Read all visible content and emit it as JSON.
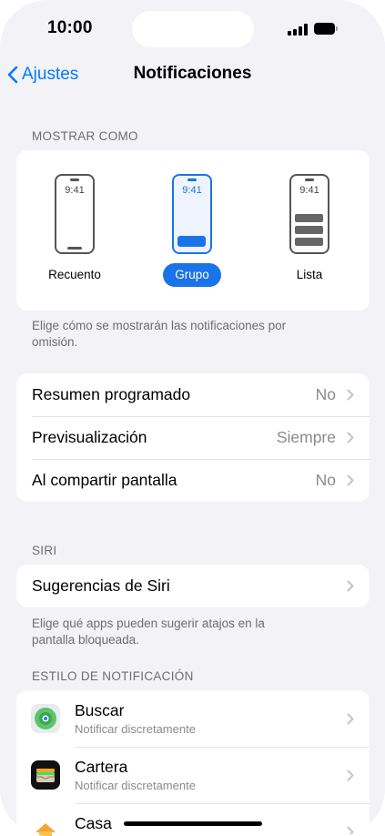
{
  "status_bar": {
    "time": "10:00"
  },
  "nav": {
    "back_label": "Ajustes",
    "title": "Notificaciones"
  },
  "display_as": {
    "header": "MOSTRAR COMO",
    "options": [
      {
        "label": "Recuento",
        "time": "9:41",
        "selected": false
      },
      {
        "label": "Grupo",
        "time": "9:41",
        "selected": true
      },
      {
        "label": "Lista",
        "time": "9:41",
        "selected": false
      }
    ],
    "footer": "Elige cómo se mostrarán las notificaciones por omisión."
  },
  "general": [
    {
      "label": "Resumen programado",
      "value": "No"
    },
    {
      "label": "Previsualización",
      "value": "Siempre"
    },
    {
      "label": "Al compartir pantalla",
      "value": "No"
    }
  ],
  "siri": {
    "header": "SIRI",
    "row_label": "Sugerencias de Siri",
    "footer": "Elige qué apps pueden sugerir atajos en la pantalla bloqueada."
  },
  "notification_style": {
    "header": "ESTILO DE NOTIFICACIÓN",
    "apps": [
      {
        "name": "Buscar",
        "subtitle": "Notificar discretamente",
        "icon": "find-my-icon"
      },
      {
        "name": "Cartera",
        "subtitle": "Notificar discretamente",
        "icon": "wallet-icon"
      },
      {
        "name": "Casa",
        "subtitle": "",
        "icon": "home-app-icon"
      }
    ]
  },
  "colors": {
    "accent": "#007aff",
    "selection": "#1a73e8",
    "background": "#f2f2f7"
  }
}
